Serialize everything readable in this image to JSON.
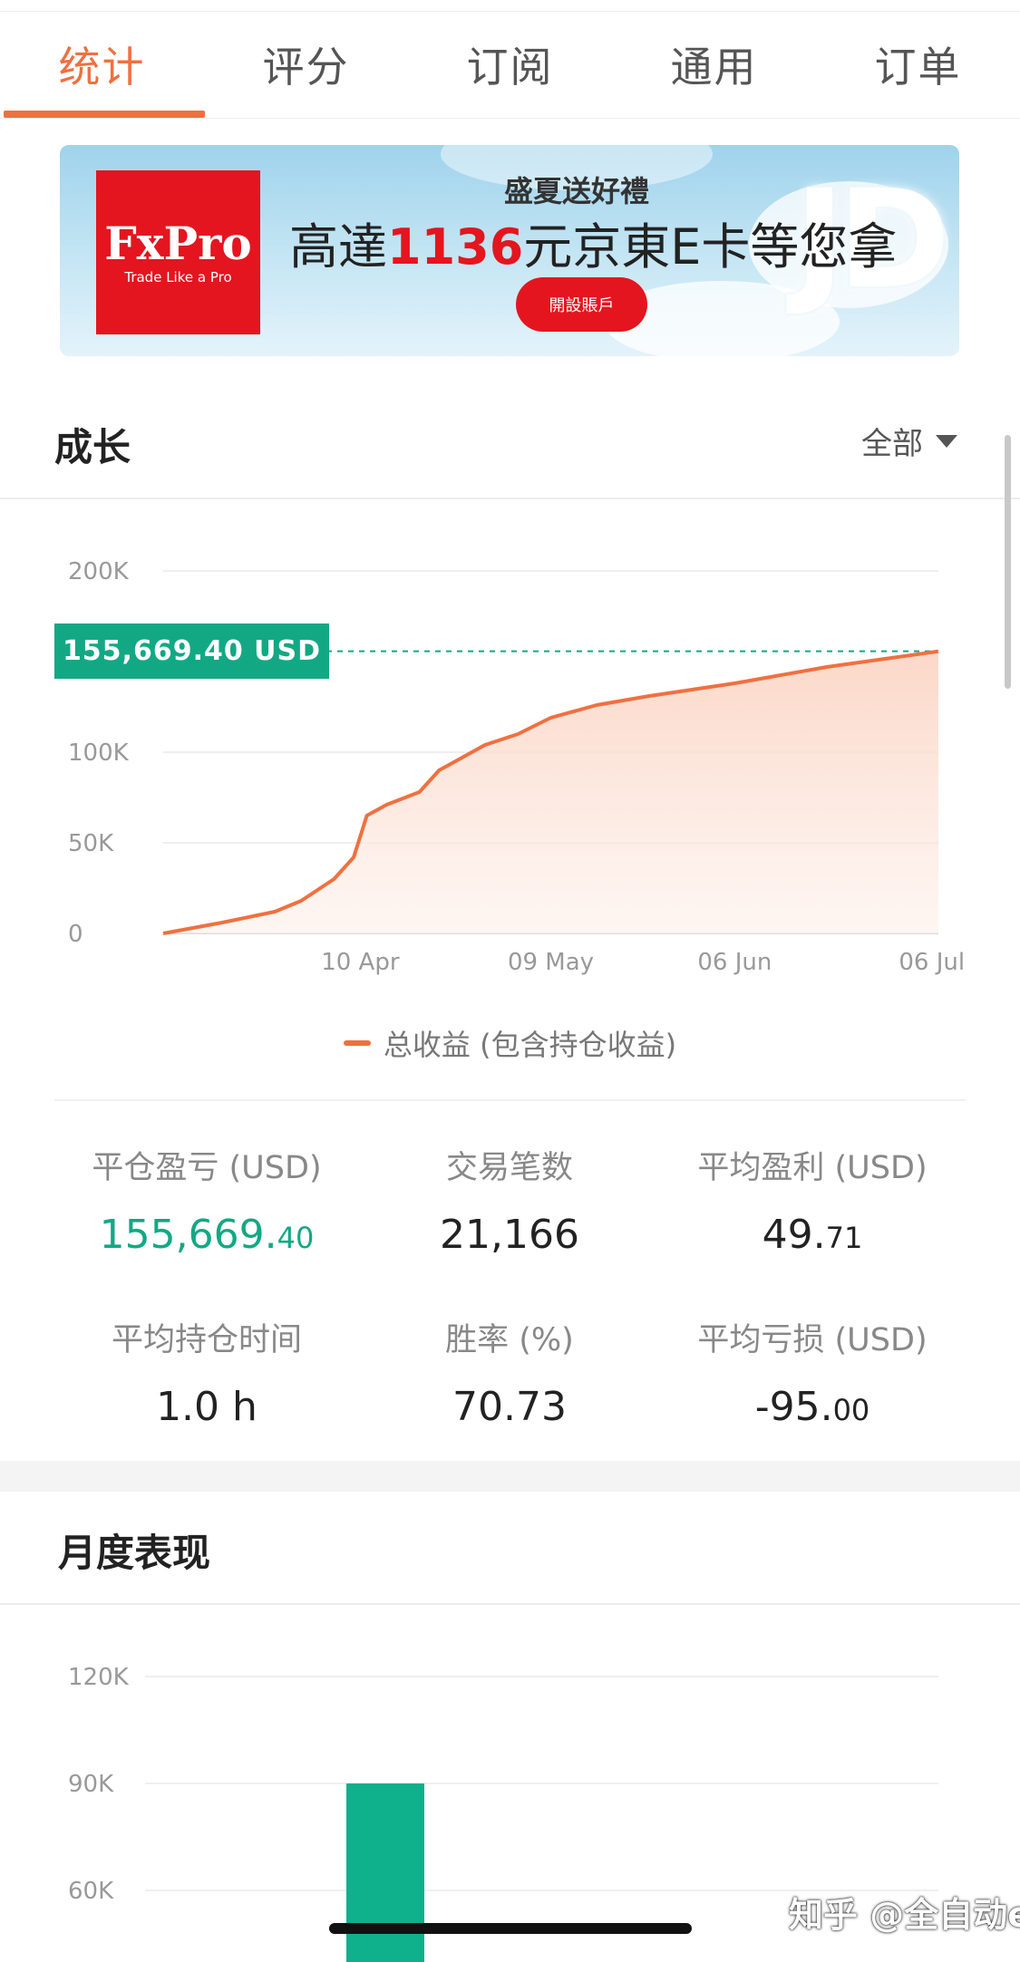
{
  "tabs": [
    "统计",
    "评分",
    "订阅",
    "通用",
    "订单"
  ],
  "active_tab": 0,
  "banner": {
    "brand": "FxPro",
    "tagline": "Trade Like a Pro",
    "headline": "盛夏送好禮",
    "main_prefix": "高達",
    "main_amount": "1136",
    "main_suffix": "元京東E卡等您拿",
    "button": "開設賬戶",
    "jd_mark": "JD"
  },
  "growth": {
    "title": "成长",
    "filter": "全部",
    "current_value": "155,669.40 USD",
    "legend": "总收益 (包含持仓收益)"
  },
  "chart_data": [
    {
      "type": "area",
      "title": "",
      "series_name": "总收益 (包含持仓收益)",
      "y_ticks": [
        "200K",
        "100K",
        "50K",
        "0"
      ],
      "x_ticks": [
        "10 Apr",
        "09 May",
        "06 Jun",
        "06 Jul"
      ],
      "ylim": [
        0,
        200000
      ],
      "x_dates": [
        "2024-03-11",
        "2024-03-20",
        "2024-03-28",
        "2024-04-01",
        "2024-04-06",
        "2024-04-09",
        "2024-04-11",
        "2024-04-14",
        "2024-04-19",
        "2024-04-22",
        "2024-04-25",
        "2024-04-29",
        "2024-05-04",
        "2024-05-09",
        "2024-05-16",
        "2024-05-24",
        "2024-06-06",
        "2024-06-20",
        "2024-07-07"
      ],
      "y_values": [
        0,
        6000,
        12000,
        18000,
        30000,
        42000,
        65000,
        71000,
        78000,
        90000,
        96000,
        104000,
        110000,
        119000,
        126000,
        131000,
        138000,
        147000,
        155669.4
      ],
      "reference_line": 155669.4,
      "colors": {
        "line": "#f07040",
        "fill": "#fde2d6",
        "reference": "#13a884"
      }
    },
    {
      "type": "bar",
      "title": "月度表现",
      "y_ticks": [
        "120K",
        "90K",
        "60K"
      ],
      "ylim": [
        0,
        120000
      ],
      "bars": [
        {
          "value": 90000,
          "color": "#0fb08c"
        }
      ]
    }
  ],
  "stats": [
    {
      "label": "平仓盈亏 (USD)",
      "int": "155,669.",
      "dec": "40",
      "color": "green"
    },
    {
      "label": "交易笔数",
      "int": "21,166",
      "dec": "",
      "color": "default"
    },
    {
      "label": "平均盈利 (USD)",
      "int": "49.",
      "dec": "71",
      "color": "default"
    },
    {
      "label": "平均持仓时间",
      "int": "1.0 h",
      "dec": "",
      "color": "default"
    },
    {
      "label": "胜率 (%)",
      "int": "70.73",
      "dec": "",
      "color": "default"
    },
    {
      "label": "平均亏损 (USD)",
      "int": "-95.",
      "dec": "00",
      "color": "default"
    }
  ],
  "monthly": {
    "title": "月度表现"
  },
  "watermark": "知乎 @全自动ea"
}
